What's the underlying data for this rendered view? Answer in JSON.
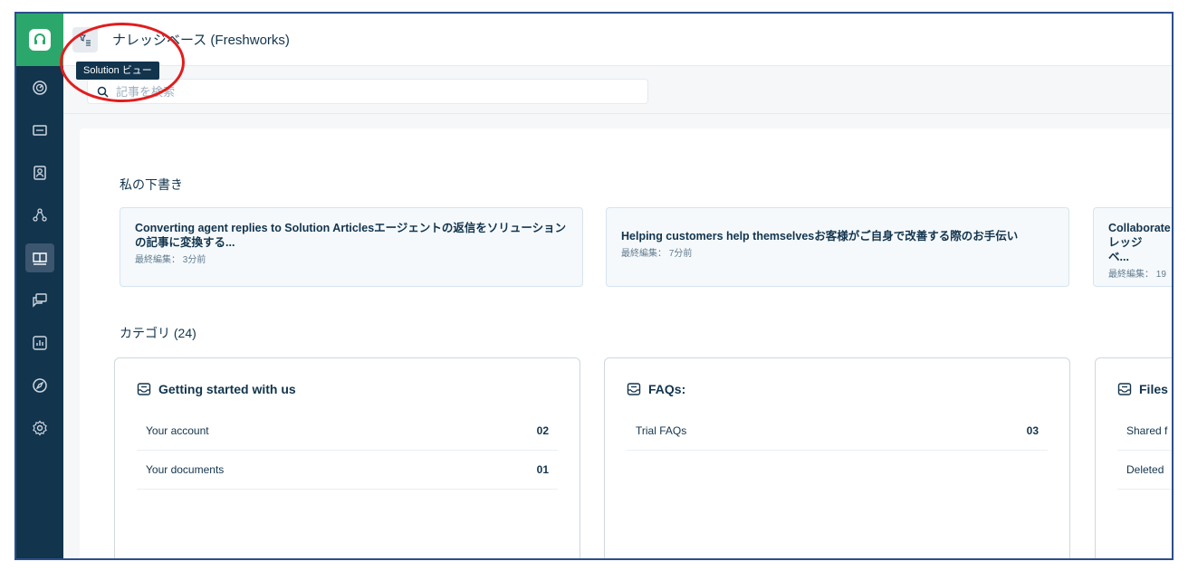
{
  "header": {
    "title": "ナレッジベース (Freshworks)",
    "tooltip": "Solution ビュー"
  },
  "search": {
    "placeholder": "記事を検索"
  },
  "drafts": {
    "section_title": "私の下書き",
    "items": [
      {
        "title": "Converting agent replies to Solution Articlesエージェントの返信をソリューションの記事に変換する...",
        "meta": "最終編集： 3分前"
      },
      {
        "title": "Helping customers help themselvesお客様がご自身で改善する際のお手伝い",
        "meta": "最終編集： 7分前"
      },
      {
        "title": "Collaborate レッジベ...",
        "meta": "最終編集： 19"
      }
    ]
  },
  "categories": {
    "section_title": "カテゴリ (24)",
    "items": [
      {
        "name": "Getting started with us",
        "folders": [
          {
            "name": "Your account",
            "count": "02"
          },
          {
            "name": "Your documents",
            "count": "01"
          }
        ]
      },
      {
        "name": "FAQs:",
        "folders": [
          {
            "name": "Trial FAQs",
            "count": "03"
          }
        ]
      },
      {
        "name": "Files",
        "folders": [
          {
            "name": "Shared f",
            "count": ""
          },
          {
            "name": "Deleted",
            "count": ""
          }
        ]
      }
    ]
  },
  "colors": {
    "sidebar": "#12344d",
    "logo": "#2ca76b",
    "annotation": "#e11d1d"
  }
}
